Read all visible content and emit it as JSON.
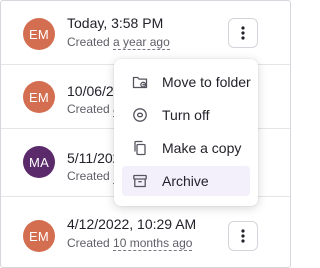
{
  "rows": [
    {
      "initials": "EM",
      "avatar_color": "#d46e51",
      "title": "Today, 3:58 PM",
      "created_prefix": "Created ",
      "created_rel": "a year ago"
    },
    {
      "initials": "EM",
      "avatar_color": "#d46e51",
      "title": "10/06/2",
      "created_prefix": "Created ",
      "created_rel": "a"
    },
    {
      "initials": "MA",
      "avatar_color": "#5b2a6b",
      "title": "5/11/202",
      "created_prefix": "Created ",
      "created_rel": "1"
    },
    {
      "initials": "EM",
      "avatar_color": "#d46e51",
      "title": "4/12/2022, 10:29 AM",
      "created_prefix": "Created ",
      "created_rel": "10 months ago"
    }
  ],
  "menu": {
    "items": [
      {
        "label": "Move to folder",
        "icon": "folder-move-icon"
      },
      {
        "label": "Turn off",
        "icon": "power-off-icon"
      },
      {
        "label": "Make a copy",
        "icon": "copy-icon"
      },
      {
        "label": "Archive",
        "icon": "archive-icon",
        "active": true
      }
    ]
  },
  "colors": {
    "accent_highlight": "#f3effb",
    "avatar_orange": "#d46e51",
    "avatar_purple": "#5b2a6b"
  }
}
